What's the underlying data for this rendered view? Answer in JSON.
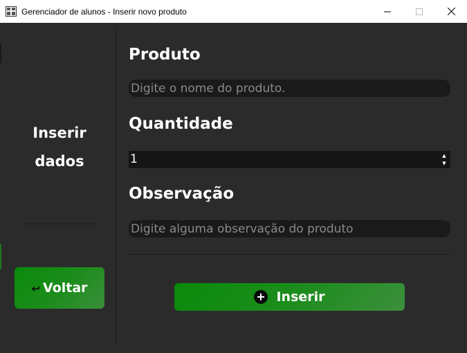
{
  "window": {
    "title": "Gerenciador de alunos - Inserir novo produto",
    "minimize_glyph": "—",
    "maximize_glyph": "☐",
    "close_glyph": "✕"
  },
  "sidebar": {
    "title_line1": "Inserir",
    "title_line2": "dados",
    "back_button": {
      "icon": "return-arrow-icon",
      "icon_glyph": "↩",
      "label": "Voltar"
    }
  },
  "form": {
    "product": {
      "label": "Produto",
      "placeholder": "Digite o nome do produto.",
      "value": ""
    },
    "quantity": {
      "label": "Quantidade",
      "value": "1"
    },
    "observation": {
      "label": "Observação",
      "placeholder": "Digite alguma observação do produto",
      "value": ""
    },
    "submit_button": {
      "icon": "plus-circle-icon",
      "label": "Inserir"
    }
  },
  "colors": {
    "background": "#2b2b2b",
    "input_background": "#1a1a1a",
    "accent_green": "#1b8c1b",
    "text": "#ffffff",
    "placeholder": "#8a8a8a"
  }
}
